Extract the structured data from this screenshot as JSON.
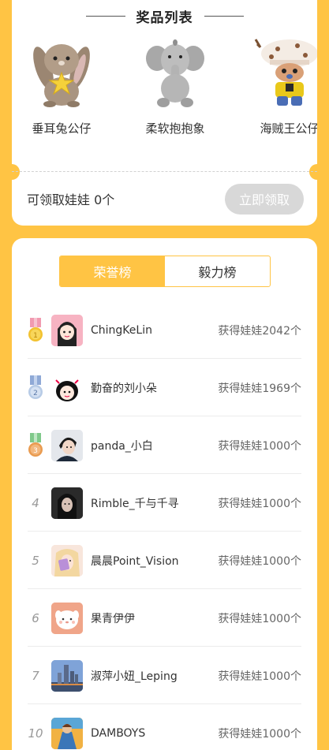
{
  "prizes": {
    "title": "奖品列表",
    "items": [
      {
        "name": "垂耳兔公仔",
        "icon": "bunny-plush-icon"
      },
      {
        "name": "柔软抱抱象",
        "icon": "elephant-plush-icon"
      },
      {
        "name": "海贼王公仔",
        "icon": "chopper-plush-icon"
      }
    ],
    "claim_text": "可领取娃娃 0个",
    "claim_button": "立即领取"
  },
  "ranking": {
    "tabs": [
      {
        "label": "荣誉榜",
        "active": true
      },
      {
        "label": "毅力榜",
        "active": false
      }
    ],
    "rows": [
      {
        "rank": "1",
        "badge": "gold",
        "name": "ChingKeLin",
        "count": "获得娃娃2042个"
      },
      {
        "rank": "2",
        "badge": "silver",
        "name": "勤奋的刘小朵",
        "count": "获得娃娃1969个"
      },
      {
        "rank": "3",
        "badge": "bronze",
        "name": "panda_小白",
        "count": "获得娃娃1000个"
      },
      {
        "rank": "4",
        "badge": "",
        "name": "Rimble_千与千寻",
        "count": "获得娃娃1000个"
      },
      {
        "rank": "5",
        "badge": "",
        "name": "晨晨Point_Vision",
        "count": "获得娃娃1000个"
      },
      {
        "rank": "6",
        "badge": "",
        "name": "果青伊伊",
        "count": "获得娃娃1000个"
      },
      {
        "rank": "7",
        "badge": "",
        "name": "淑萍小妞_Leping",
        "count": "获得娃娃1000个"
      },
      {
        "rank": "10",
        "badge": "",
        "name": "DAMBOYS",
        "count": "获得娃娃1000个"
      }
    ]
  },
  "colors": {
    "accent": "#FFC444",
    "disabled_button": "#D8D8D8",
    "gold": "#F2C230",
    "silver": "#B7CBE6",
    "bronze": "#E99B50"
  }
}
